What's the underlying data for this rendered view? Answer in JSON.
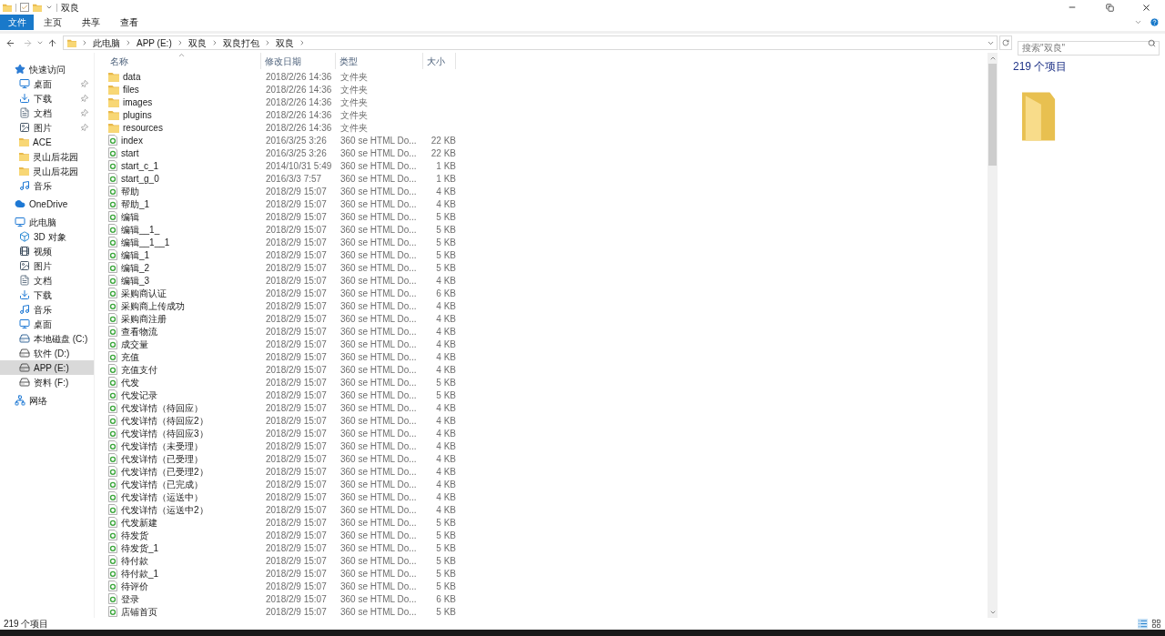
{
  "window": {
    "title": "双良"
  },
  "ribbon": {
    "file_menu": "文件",
    "tabs": [
      "主页",
      "共享",
      "查看"
    ]
  },
  "address": {
    "path": [
      "此电脑",
      "APP (E:)",
      "双良",
      "双良打包",
      "双良"
    ]
  },
  "search": {
    "placeholder": "搜索\"双良\""
  },
  "sidebar": {
    "items": [
      {
        "label": "快速访问",
        "kind": "star",
        "selected": false,
        "children": [
          {
            "label": "桌面",
            "kind": "desktop",
            "pinned": true,
            "selected": false
          },
          {
            "label": "下载",
            "kind": "download",
            "pinned": true,
            "selected": false
          },
          {
            "label": "文档",
            "kind": "document",
            "pinned": true,
            "selected": false
          },
          {
            "label": "图片",
            "kind": "pictures",
            "pinned": true,
            "selected": false
          },
          {
            "label": "ACE",
            "kind": "folder",
            "pinned": false,
            "selected": false
          },
          {
            "label": "灵山后花园",
            "kind": "folder",
            "pinned": false,
            "selected": false
          },
          {
            "label": "灵山后花园",
            "kind": "folder",
            "pinned": false,
            "selected": false
          },
          {
            "label": "音乐",
            "kind": "music",
            "pinned": false,
            "selected": false
          }
        ]
      },
      {
        "label": "OneDrive",
        "kind": "cloud",
        "selected": false
      },
      {
        "label": "此电脑",
        "kind": "pc",
        "selected": false,
        "children": [
          {
            "label": "3D 对象",
            "kind": "cube",
            "selected": false
          },
          {
            "label": "视频",
            "kind": "video",
            "selected": false
          },
          {
            "label": "图片",
            "kind": "pictures",
            "selected": false
          },
          {
            "label": "文档",
            "kind": "document",
            "selected": false
          },
          {
            "label": "下载",
            "kind": "download",
            "selected": false
          },
          {
            "label": "音乐",
            "kind": "music",
            "selected": false
          },
          {
            "label": "桌面",
            "kind": "desktop",
            "selected": false
          },
          {
            "label": "本地磁盘 (C:)",
            "kind": "sysdrive",
            "selected": false
          },
          {
            "label": "软件 (D:)",
            "kind": "drive",
            "selected": false
          },
          {
            "label": "APP (E:)",
            "kind": "drive",
            "selected": true
          },
          {
            "label": "资料 (F:)",
            "kind": "drive",
            "selected": false
          }
        ]
      },
      {
        "label": "网络",
        "kind": "network",
        "selected": false
      }
    ]
  },
  "table": {
    "columns": [
      "名称",
      "修改日期",
      "类型",
      "大小"
    ],
    "rows": [
      {
        "kind": "folder",
        "name": "data",
        "date": "2018/2/26 14:36",
        "type": "文件夹"
      },
      {
        "kind": "folder",
        "name": "files",
        "date": "2018/2/26 14:36",
        "type": "文件夹"
      },
      {
        "kind": "folder",
        "name": "images",
        "date": "2018/2/26 14:36",
        "type": "文件夹"
      },
      {
        "kind": "folder",
        "name": "plugins",
        "date": "2018/2/26 14:36",
        "type": "文件夹"
      },
      {
        "kind": "folder",
        "name": "resources",
        "date": "2018/2/26 14:36",
        "type": "文件夹"
      },
      {
        "kind": "html",
        "name": "index",
        "date": "2016/3/25 3:26",
        "type": "360 se HTML Do...",
        "size": "22 KB"
      },
      {
        "kind": "html",
        "name": "start",
        "date": "2016/3/25 3:26",
        "type": "360 se HTML Do...",
        "size": "22 KB"
      },
      {
        "kind": "html",
        "name": "start_c_1",
        "date": "2014/10/31 5:49",
        "type": "360 se HTML Do...",
        "size": "1 KB"
      },
      {
        "kind": "html",
        "name": "start_g_0",
        "date": "2016/3/3 7:57",
        "type": "360 se HTML Do...",
        "size": "1 KB"
      },
      {
        "kind": "html",
        "name": "帮助",
        "date": "2018/2/9 15:07",
        "type": "360 se HTML Do...",
        "size": "4 KB"
      },
      {
        "kind": "html",
        "name": "帮助_1",
        "date": "2018/2/9 15:07",
        "type": "360 se HTML Do...",
        "size": "4 KB"
      },
      {
        "kind": "html",
        "name": "编辑",
        "date": "2018/2/9 15:07",
        "type": "360 se HTML Do...",
        "size": "5 KB"
      },
      {
        "kind": "html",
        "name": "编辑__1_",
        "date": "2018/2/9 15:07",
        "type": "360 se HTML Do...",
        "size": "5 KB"
      },
      {
        "kind": "html",
        "name": "编辑__1__1",
        "date": "2018/2/9 15:07",
        "type": "360 se HTML Do...",
        "size": "5 KB"
      },
      {
        "kind": "html",
        "name": "编辑_1",
        "date": "2018/2/9 15:07",
        "type": "360 se HTML Do...",
        "size": "5 KB"
      },
      {
        "kind": "html",
        "name": "编辑_2",
        "date": "2018/2/9 15:07",
        "type": "360 se HTML Do...",
        "size": "5 KB"
      },
      {
        "kind": "html",
        "name": "编辑_3",
        "date": "2018/2/9 15:07",
        "type": "360 se HTML Do...",
        "size": "4 KB"
      },
      {
        "kind": "html",
        "name": "采购商认证",
        "date": "2018/2/9 15:07",
        "type": "360 se HTML Do...",
        "size": "6 KB"
      },
      {
        "kind": "html",
        "name": "采购商上传成功",
        "date": "2018/2/9 15:07",
        "type": "360 se HTML Do...",
        "size": "4 KB"
      },
      {
        "kind": "html",
        "name": "采购商注册",
        "date": "2018/2/9 15:07",
        "type": "360 se HTML Do...",
        "size": "4 KB"
      },
      {
        "kind": "html",
        "name": "查看物流",
        "date": "2018/2/9 15:07",
        "type": "360 se HTML Do...",
        "size": "4 KB"
      },
      {
        "kind": "html",
        "name": "成交量",
        "date": "2018/2/9 15:07",
        "type": "360 se HTML Do...",
        "size": "4 KB"
      },
      {
        "kind": "html",
        "name": "充值",
        "date": "2018/2/9 15:07",
        "type": "360 se HTML Do...",
        "size": "4 KB"
      },
      {
        "kind": "html",
        "name": "充值支付",
        "date": "2018/2/9 15:07",
        "type": "360 se HTML Do...",
        "size": "4 KB"
      },
      {
        "kind": "html",
        "name": "代发",
        "date": "2018/2/9 15:07",
        "type": "360 se HTML Do...",
        "size": "5 KB"
      },
      {
        "kind": "html",
        "name": "代发记录",
        "date": "2018/2/9 15:07",
        "type": "360 se HTML Do...",
        "size": "5 KB"
      },
      {
        "kind": "html",
        "name": "代发详情（待回应）",
        "date": "2018/2/9 15:07",
        "type": "360 se HTML Do...",
        "size": "4 KB"
      },
      {
        "kind": "html",
        "name": "代发详情（待回应2）",
        "date": "2018/2/9 15:07",
        "type": "360 se HTML Do...",
        "size": "4 KB"
      },
      {
        "kind": "html",
        "name": "代发详情（待回应3）",
        "date": "2018/2/9 15:07",
        "type": "360 se HTML Do...",
        "size": "4 KB"
      },
      {
        "kind": "html",
        "name": "代发详情（未受理）",
        "date": "2018/2/9 15:07",
        "type": "360 se HTML Do...",
        "size": "4 KB"
      },
      {
        "kind": "html",
        "name": "代发详情（已受理）",
        "date": "2018/2/9 15:07",
        "type": "360 se HTML Do...",
        "size": "4 KB"
      },
      {
        "kind": "html",
        "name": "代发详情（已受理2）",
        "date": "2018/2/9 15:07",
        "type": "360 se HTML Do...",
        "size": "4 KB"
      },
      {
        "kind": "html",
        "name": "代发详情（已完成）",
        "date": "2018/2/9 15:07",
        "type": "360 se HTML Do...",
        "size": "4 KB"
      },
      {
        "kind": "html",
        "name": "代发详情（运送中）",
        "date": "2018/2/9 15:07",
        "type": "360 se HTML Do...",
        "size": "4 KB"
      },
      {
        "kind": "html",
        "name": "代发详情（运送中2）",
        "date": "2018/2/9 15:07",
        "type": "360 se HTML Do...",
        "size": "4 KB"
      },
      {
        "kind": "html",
        "name": "代发新建",
        "date": "2018/2/9 15:07",
        "type": "360 se HTML Do...",
        "size": "5 KB"
      },
      {
        "kind": "html",
        "name": "待发货",
        "date": "2018/2/9 15:07",
        "type": "360 se HTML Do...",
        "size": "5 KB"
      },
      {
        "kind": "html",
        "name": "待发货_1",
        "date": "2018/2/9 15:07",
        "type": "360 se HTML Do...",
        "size": "5 KB"
      },
      {
        "kind": "html",
        "name": "待付款",
        "date": "2018/2/9 15:07",
        "type": "360 se HTML Do...",
        "size": "5 KB"
      },
      {
        "kind": "html",
        "name": "待付款_1",
        "date": "2018/2/9 15:07",
        "type": "360 se HTML Do...",
        "size": "5 KB"
      },
      {
        "kind": "html",
        "name": "待评价",
        "date": "2018/2/9 15:07",
        "type": "360 se HTML Do...",
        "size": "5 KB"
      },
      {
        "kind": "html",
        "name": "登录",
        "date": "2018/2/9 15:07",
        "type": "360 se HTML Do...",
        "size": "6 KB"
      },
      {
        "kind": "html",
        "name": "店铺首页",
        "date": "2018/2/9 15:07",
        "type": "360 se HTML Do...",
        "size": "5 KB"
      }
    ]
  },
  "details": {
    "count": "219 个项目"
  },
  "status_bar": {
    "count": "219 个项目"
  }
}
